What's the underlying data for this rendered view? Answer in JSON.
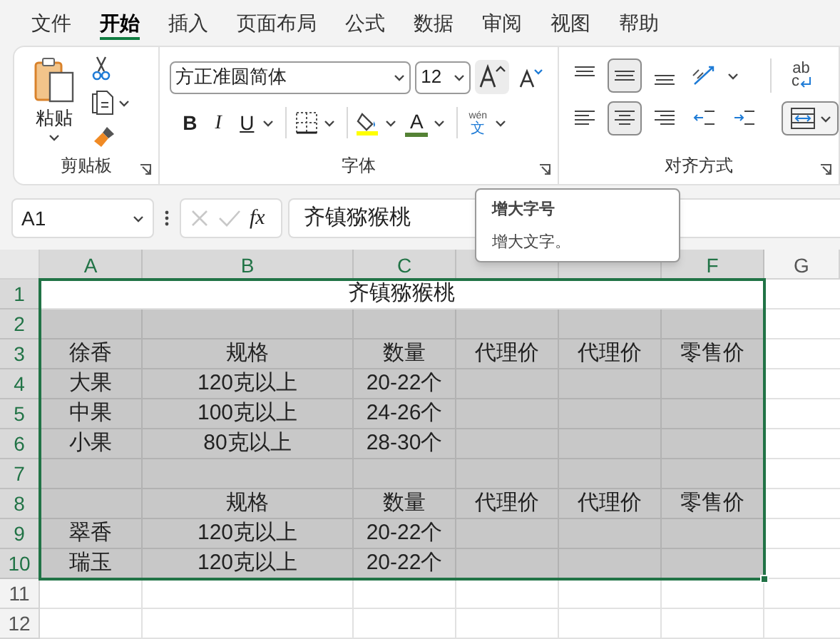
{
  "menu_tabs": [
    {
      "label": "文件",
      "selected": false
    },
    {
      "label": "开始",
      "selected": true
    },
    {
      "label": "插入",
      "selected": false
    },
    {
      "label": "页面布局",
      "selected": false
    },
    {
      "label": "公式",
      "selected": false
    },
    {
      "label": "数据",
      "selected": false
    },
    {
      "label": "审阅",
      "selected": false
    },
    {
      "label": "视图",
      "selected": false
    },
    {
      "label": "帮助",
      "selected": false
    }
  ],
  "ribbon": {
    "clipboard": {
      "paste_label": "粘贴",
      "label": "剪贴板"
    },
    "font": {
      "font_name": "方正准圆简体",
      "font_size": "12",
      "label": "字体",
      "grow_hovered": true,
      "buttons": [
        {
          "kind": "bold",
          "label": "B",
          "dropdown": false
        },
        {
          "kind": "italic",
          "label": "I",
          "dropdown": false
        },
        {
          "kind": "underline",
          "label": "U",
          "dropdown": true
        },
        {
          "kind": "borders",
          "dropdown": true
        },
        {
          "kind": "fill",
          "dropdown": true
        },
        {
          "kind": "font_color",
          "label": "A",
          "dropdown": true
        },
        {
          "kind": "phonetic",
          "label": "wén",
          "sublabel": "文",
          "dropdown": true
        }
      ]
    },
    "alignment": {
      "label": "对齐方式",
      "wrap_label": "ab",
      "wrap_sublabel": "c",
      "top_buttons": [
        {
          "kind": "top",
          "selected": false
        },
        {
          "kind": "middle",
          "selected": true
        },
        {
          "kind": "bottom",
          "selected": false
        },
        {
          "kind": "orient",
          "selected": false
        }
      ],
      "bottom_buttons": [
        {
          "kind": "left",
          "selected": false
        },
        {
          "kind": "center",
          "selected": true
        },
        {
          "kind": "right",
          "selected": false
        },
        {
          "kind": "outdent",
          "selected": false
        },
        {
          "kind": "indent",
          "selected": false
        }
      ]
    }
  },
  "formula_bar": {
    "name_box": "A1",
    "fx": "fx",
    "value": "齐镇猕猴桃"
  },
  "tooltip": {
    "title": "增大字号",
    "body": "增大文字。"
  },
  "sheet": {
    "columns": [
      {
        "label": "A",
        "selected": true
      },
      {
        "label": "B",
        "selected": true
      },
      {
        "label": "C",
        "selected": true
      },
      {
        "selected": true
      },
      {
        "selected": true
      },
      {
        "label": "F",
        "selected": true
      },
      {
        "label": "G",
        "selected": false
      }
    ],
    "rows": [
      {
        "label": "1",
        "selected": true,
        "filled": false,
        "title": "齐镇猕猴桃"
      },
      {
        "label": "2",
        "selected": true,
        "filled": true
      },
      {
        "label": "3",
        "selected": true,
        "filled": true,
        "cells": [
          "徐香",
          "规格",
          "数量",
          "代理价",
          "代理价",
          "零售价"
        ]
      },
      {
        "label": "4",
        "selected": true,
        "filled": true,
        "cells": [
          "大果",
          "120克以上",
          "20-22个"
        ]
      },
      {
        "label": "5",
        "selected": true,
        "filled": true,
        "cells": [
          "中果",
          "100克以上",
          "24-26个"
        ]
      },
      {
        "label": "6",
        "selected": true,
        "filled": true,
        "cells": [
          "小果",
          "80克以上",
          "28-30个"
        ]
      },
      {
        "label": "7",
        "selected": true,
        "filled": true
      },
      {
        "label": "8",
        "selected": true,
        "filled": true,
        "cells": [
          null,
          "规格",
          "数量",
          "代理价",
          "代理价",
          "零售价"
        ]
      },
      {
        "label": "9",
        "selected": true,
        "filled": true,
        "cells": [
          "翠香",
          "120克以上",
          "20-22个"
        ]
      },
      {
        "label": "10",
        "selected": true,
        "filled": true,
        "cells": [
          "瑞玉",
          "120克以上",
          "20-22个"
        ]
      },
      {
        "label": "11",
        "selected": false,
        "filled": false
      },
      {
        "label": "12",
        "selected": false,
        "filled": false
      }
    ]
  }
}
